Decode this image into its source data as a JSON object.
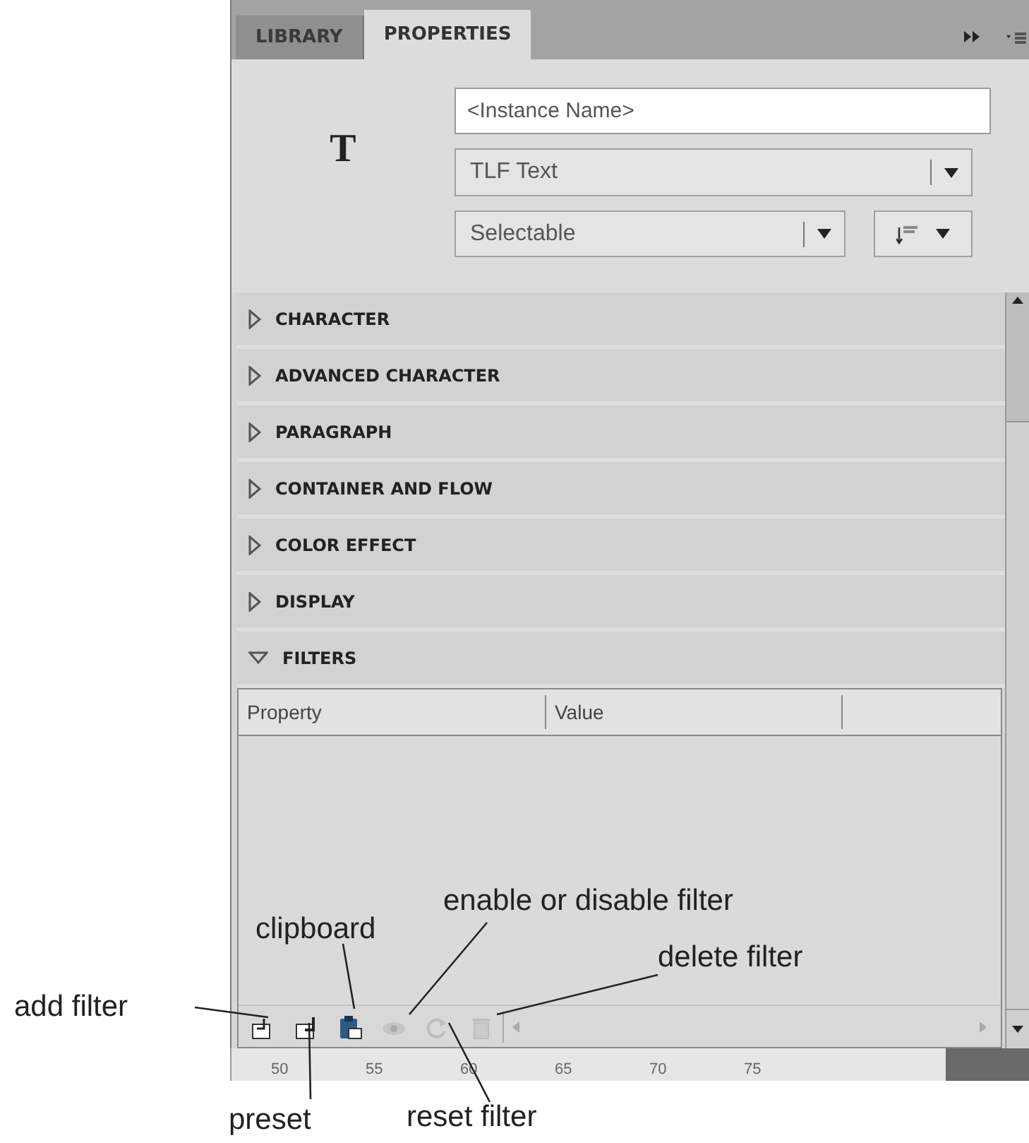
{
  "tabs": [
    {
      "label": "LIBRARY",
      "selected": false
    },
    {
      "label": "PROPERTIES",
      "selected": true
    }
  ],
  "object_type_icon": "T",
  "instance_name": {
    "placeholder": "<Instance Name>"
  },
  "text_engine": {
    "value": "TLF Text"
  },
  "text_type": {
    "value": "Selectable"
  },
  "sections": [
    {
      "label": "CHARACTER",
      "expanded": false
    },
    {
      "label": "ADVANCED CHARACTER",
      "expanded": false
    },
    {
      "label": "PARAGRAPH",
      "expanded": false
    },
    {
      "label": "CONTAINER AND FLOW",
      "expanded": false
    },
    {
      "label": "COLOR EFFECT",
      "expanded": false
    },
    {
      "label": "DISPLAY",
      "expanded": false
    },
    {
      "label": "FILTERS",
      "expanded": true
    }
  ],
  "filters_table": {
    "columns": [
      "Property",
      "Value"
    ]
  },
  "filter_toolbar": [
    {
      "kind": "add",
      "disabled": false
    },
    {
      "kind": "preset",
      "disabled": false
    },
    {
      "kind": "clipboard",
      "disabled": false
    },
    {
      "kind": "enable",
      "disabled": true
    },
    {
      "kind": "reset",
      "disabled": true
    },
    {
      "kind": "delete",
      "disabled": true
    }
  ],
  "ruler": [
    "50",
    "55",
    "60",
    "65",
    "70",
    "75"
  ],
  "annotations": [
    {
      "text": "add filter"
    },
    {
      "text": "preset"
    },
    {
      "text": "clipboard"
    },
    {
      "text": "enable or disable filter"
    },
    {
      "text": "reset filter"
    },
    {
      "text": "delete filter"
    }
  ]
}
